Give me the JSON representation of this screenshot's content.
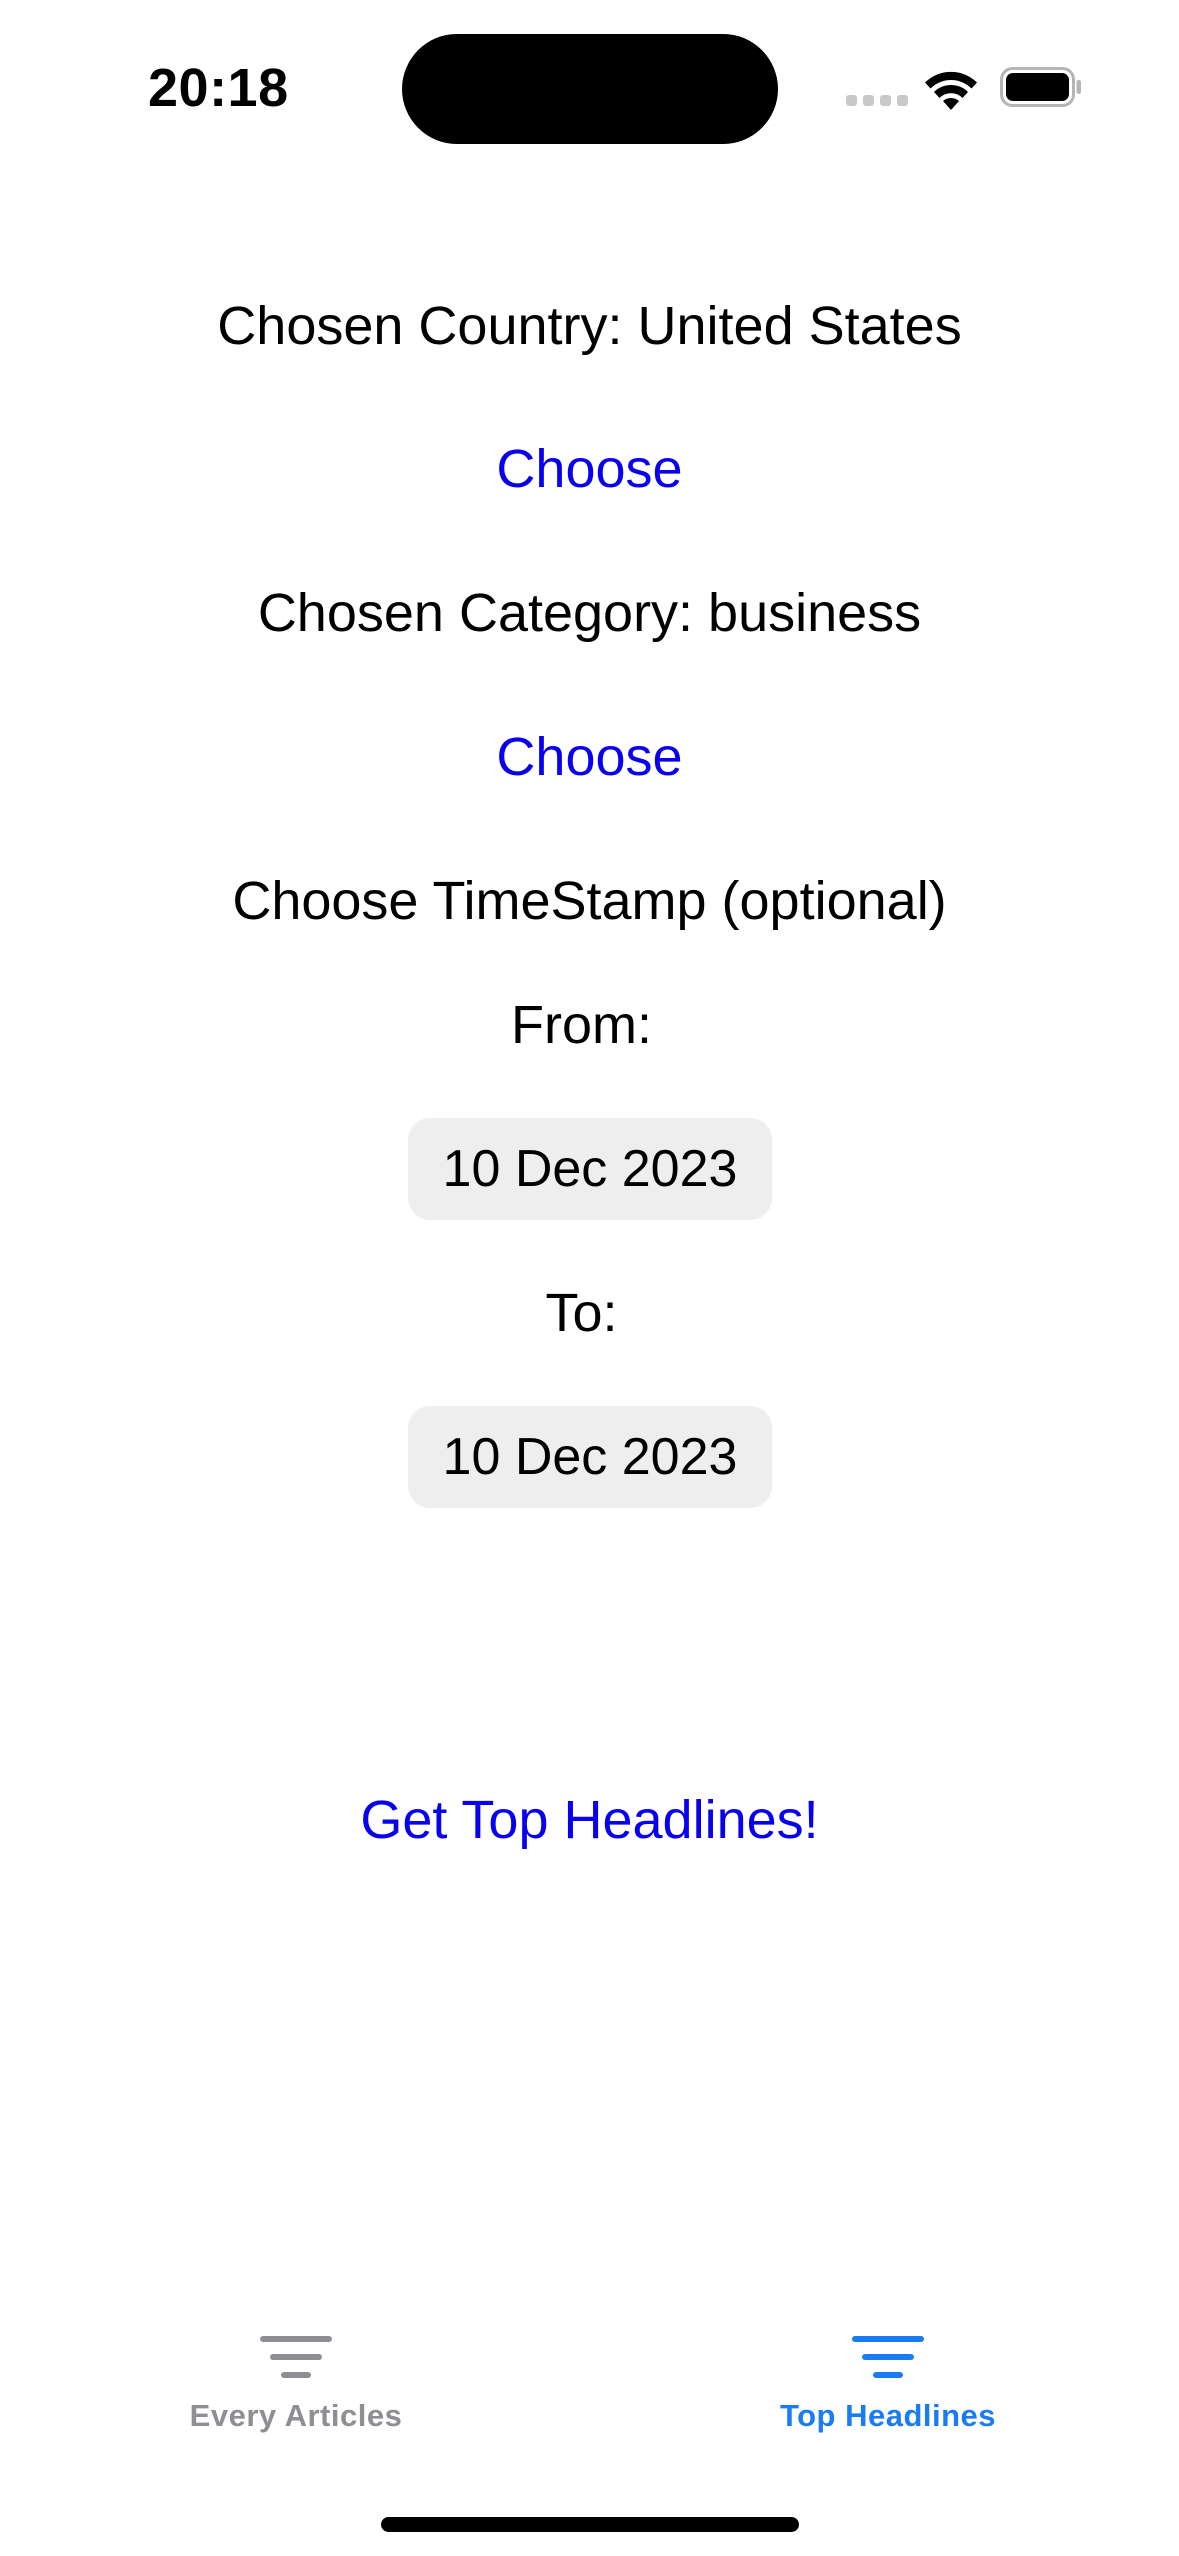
{
  "status_bar": {
    "time": "20:18",
    "signal_icon": "cellular-signal-icon",
    "wifi_icon": "wifi-icon",
    "battery_icon": "battery-icon"
  },
  "main": {
    "country_label": "Chosen Country: United States",
    "country_choose_label": "Choose",
    "category_label": "Chosen Category:  business",
    "category_choose_label": "Choose",
    "timestamp_label": "Choose TimeStamp (optional)",
    "from_label": "From:",
    "from_date": "10 Dec 2023",
    "to_label": "To:",
    "to_date": "10 Dec 2023",
    "get_headlines_label": "Get Top Headlines!"
  },
  "tab_bar": {
    "tabs": [
      {
        "label": "Every Articles",
        "icon": "lines-icon",
        "selected": false
      },
      {
        "label": "Top Headlines",
        "icon": "lines-icon",
        "selected": true
      }
    ]
  },
  "colors": {
    "link": "#0a00f0",
    "tab_selected": "#1a7cf5",
    "tab_unselected": "#8e8e93",
    "date_pill_bg": "#eeeeef"
  }
}
